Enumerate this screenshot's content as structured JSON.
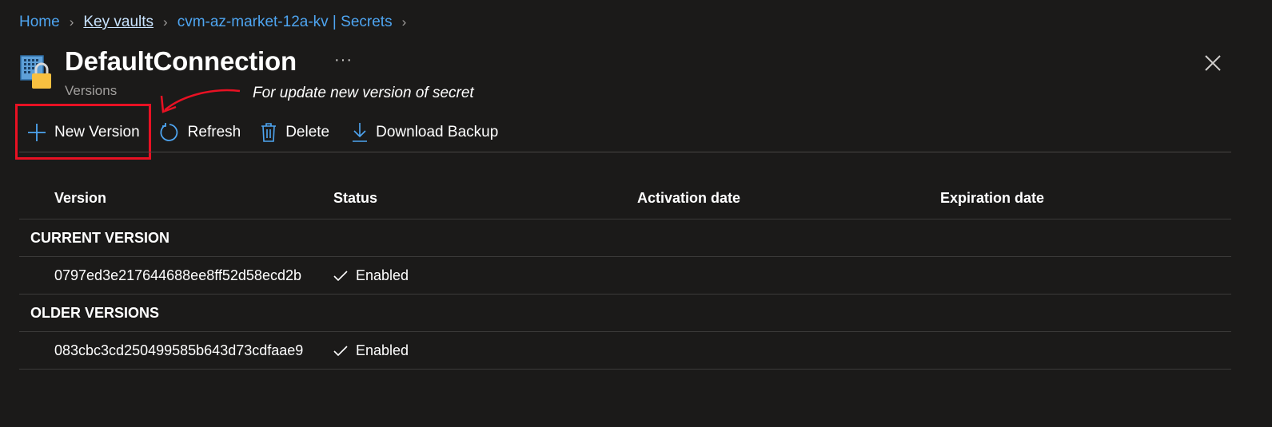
{
  "breadcrumb": {
    "items": [
      "Home",
      "Key vaults",
      "cvm-az-market-12a-kv | Secrets"
    ]
  },
  "header": {
    "title": "DefaultConnection",
    "subtitle": "Versions",
    "more_label": "···"
  },
  "annotation": {
    "text": "For update new version of secret",
    "color": "#e81123"
  },
  "toolbar": {
    "new_version": "New Version",
    "refresh": "Refresh",
    "delete": "Delete",
    "download_backup": "Download Backup"
  },
  "table": {
    "columns": [
      "Version",
      "Status",
      "Activation date",
      "Expiration date"
    ],
    "groups": [
      {
        "label": "CURRENT VERSION",
        "rows": [
          {
            "version": "0797ed3e217644688ee8ff52d58ecd2b",
            "status": "Enabled",
            "activation": "",
            "expiration": ""
          }
        ]
      },
      {
        "label": "OLDER VERSIONS",
        "rows": [
          {
            "version": "083cbc3cd250499585b643d73cdfaae9",
            "status": "Enabled",
            "activation": "",
            "expiration": ""
          }
        ]
      }
    ]
  },
  "colors": {
    "background": "#1b1a19",
    "link": "#4ea5f1",
    "icon_blue": "#3a96dd",
    "lock_gold": "#f8c040"
  },
  "icons": {
    "vault": "key-vault-icon",
    "close": "close-icon",
    "new_version": "plus-icon",
    "refresh": "refresh-icon",
    "delete": "trash-icon",
    "download": "download-icon",
    "status": "check-icon"
  }
}
